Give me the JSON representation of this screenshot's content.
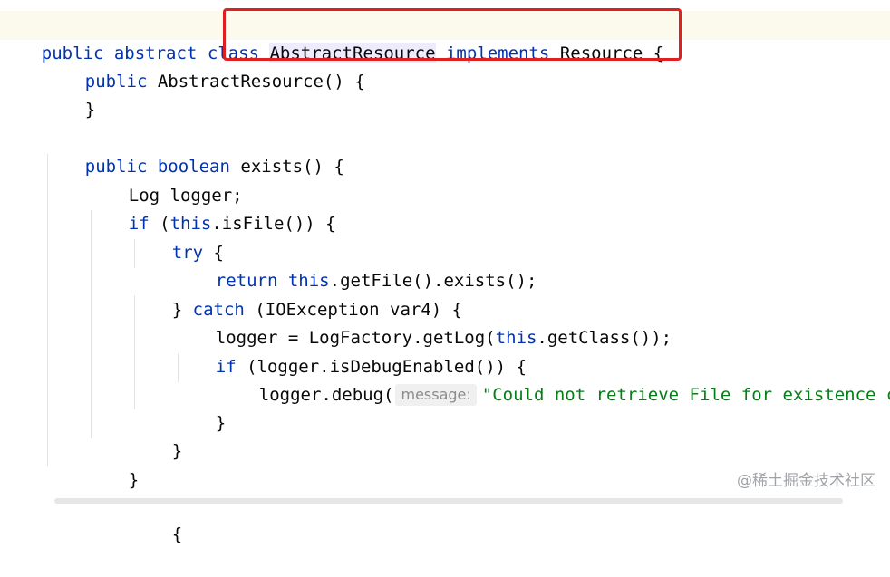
{
  "code": {
    "l1": {
      "public": "public",
      "abstract": "abstract",
      "class": "class",
      "name": "AbstractResource",
      "implements": "implements",
      "iface": "Resource",
      "brace": "{"
    },
    "l2": {
      "public": "public",
      "ctor": "AbstractResource() {"
    },
    "l3": {
      "brace": "}"
    },
    "l5": {
      "public": "public",
      "boolean": "boolean",
      "rest": "exists() {"
    },
    "l6": {
      "text": "Log logger;"
    },
    "l7": {
      "if": "if",
      "open": "(",
      "this": "this",
      "rest": ".isFile()) {"
    },
    "l8": {
      "try": "try",
      "rest": "{"
    },
    "l9": {
      "return": "return",
      "this": "this",
      "rest": ".getFile().exists();"
    },
    "l10": {
      "close": "}",
      "catch": "catch",
      "rest": "(IOException var4) {"
    },
    "l11": {
      "pre": "logger = LogFactory.getLog(",
      "this": "this",
      "rest": ".getClass());"
    },
    "l12": {
      "if": "if",
      "rest": "(logger.isDebugEnabled()) {"
    },
    "l13": {
      "pre": "logger.debug(",
      "hint": "message:",
      "str": "\"Could not retrieve File for existence ch"
    },
    "l14": {
      "brace": "}"
    },
    "l15": {
      "brace": "}"
    },
    "l16": {
      "brace": "}"
    },
    "l18": {
      "text": "{"
    }
  },
  "watermark": "@稀土掘金技术社区",
  "colors": {
    "keyword": "#0033b3",
    "string": "#067d17",
    "highlight_box": "#e02020",
    "current_line": "#fcfaed"
  }
}
